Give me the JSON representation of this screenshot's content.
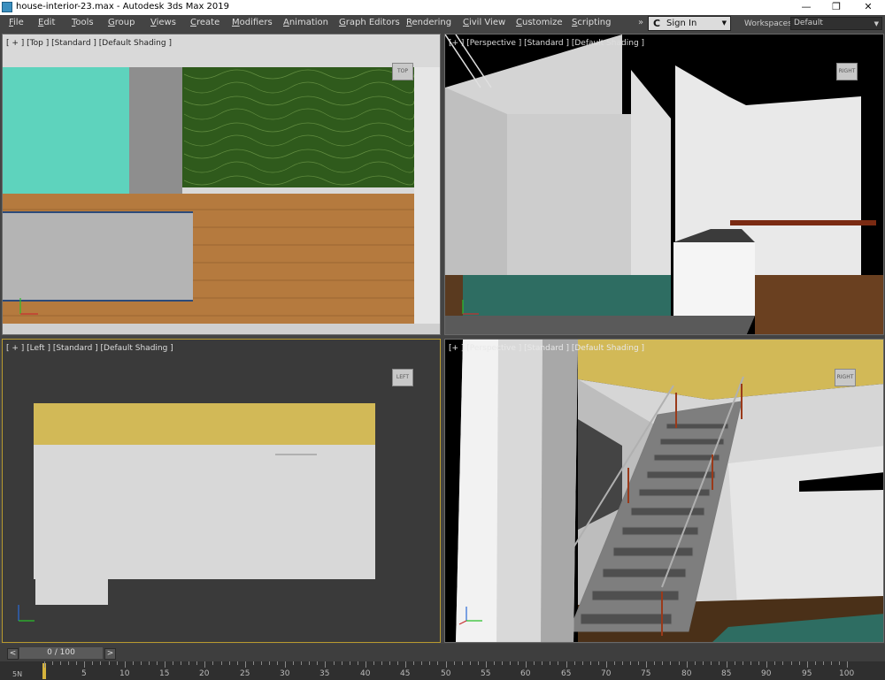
{
  "window": {
    "title": "house-interior-23.max - Autodesk 3ds Max 2019",
    "minimize": "—",
    "maximize": "❐",
    "close": "✕"
  },
  "menu": {
    "items": [
      "File",
      "Edit",
      "Tools",
      "Group",
      "Views",
      "Create",
      "Modifiers",
      "Animation",
      "Graph Editors",
      "Rendering",
      "Civil View",
      "Customize",
      "Scripting"
    ],
    "more": "»"
  },
  "signin": {
    "label": "Sign In",
    "icon": "C"
  },
  "workspaces": {
    "label": "Workspaces:",
    "value": "Default"
  },
  "viewports": {
    "top_left": {
      "label": "[ + ] [Top ] [Standard ] [Default Shading ]",
      "cube": "TOP"
    },
    "top_right": {
      "label": "[+ ] [Perspective ] [Standard ] [Default Shading ]",
      "cube": "RIGHT"
    },
    "bottom_left": {
      "label": "[ + ] [Left ] [Standard ] [Default Shading ]",
      "cube": "LEFT"
    },
    "bottom_right": {
      "label": "[+ ] [Perspective ] [Standard ] [Default Shading ]",
      "cube": "RIGHT"
    }
  },
  "timeline": {
    "frame": "0 / 100",
    "prev": "<",
    "next": ">",
    "corner": "5N",
    "ticks": [
      "5",
      "10",
      "15",
      "20",
      "25",
      "30",
      "35",
      "40",
      "45",
      "50",
      "55",
      "60",
      "65",
      "70",
      "75",
      "80",
      "85",
      "90",
      "95",
      "100"
    ]
  },
  "colors": {
    "accent": "#d6b33c",
    "wall": "#d2b957",
    "floor": "#b57a3e",
    "teal": "#5ed3bd",
    "grass": "#2f5a1c"
  }
}
